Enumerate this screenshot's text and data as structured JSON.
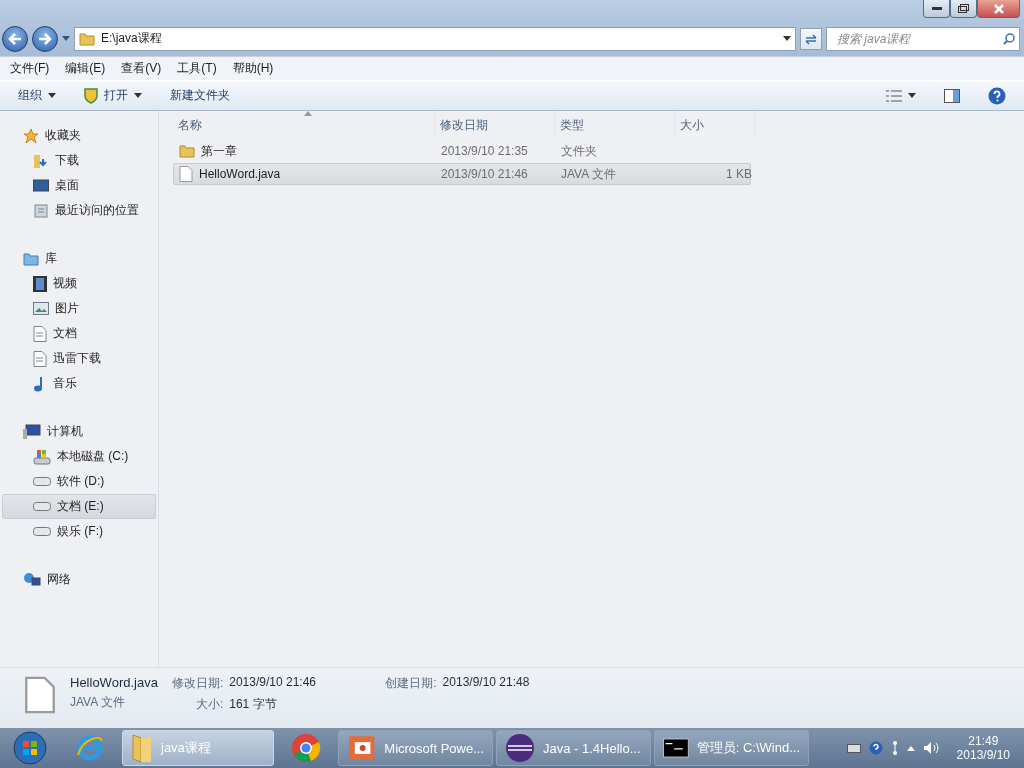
{
  "address": {
    "path": "E:\\java课程",
    "search_placeholder": "搜索 java课程"
  },
  "menu": [
    "文件(F)",
    "编辑(E)",
    "查看(V)",
    "工具(T)",
    "帮助(H)"
  ],
  "toolbar": [
    {
      "label": "组织",
      "kind": "dropdown"
    },
    {
      "label": "打开",
      "kind": "open"
    },
    {
      "label": "新建文件夹",
      "kind": "plain"
    }
  ],
  "sidebar": [
    {
      "label": "收藏夹",
      "kind": "star",
      "children": [
        {
          "label": "下载",
          "kind": "download",
          "selected": false
        },
        {
          "label": "桌面",
          "kind": "desktop",
          "selected": false
        },
        {
          "label": "最近访问的位置",
          "kind": "recent",
          "selected": false
        }
      ]
    },
    {
      "label": "库",
      "kind": "library",
      "children": [
        {
          "label": "视频",
          "kind": "video",
          "selected": false
        },
        {
          "label": "图片",
          "kind": "picture",
          "selected": false
        },
        {
          "label": "文档",
          "kind": "document",
          "selected": false
        },
        {
          "label": "迅雷下载",
          "kind": "document",
          "selected": false
        },
        {
          "label": "音乐",
          "kind": "music",
          "selected": false
        }
      ]
    },
    {
      "label": "计算机",
      "kind": "computer",
      "children": [
        {
          "label": "本地磁盘 (C:)",
          "kind": "system-drive",
          "selected": false
        },
        {
          "label": "软件 (D:)",
          "kind": "drive",
          "selected": false
        },
        {
          "label": "文档 (E:)",
          "kind": "drive",
          "selected": true
        },
        {
          "label": "娱乐 (F:)",
          "kind": "drive",
          "selected": false
        }
      ]
    },
    {
      "label": "网络",
      "kind": "network"
    }
  ],
  "columns": [
    {
      "label": "名称",
      "sorted": true
    },
    {
      "label": "修改日期",
      "sorted": false
    },
    {
      "label": "类型",
      "sorted": false
    },
    {
      "label": "大小",
      "sorted": false
    }
  ],
  "rows": [
    {
      "name": "第一章",
      "date": "2013/9/10 21:35",
      "type": "文件夹",
      "kind": "folder",
      "selected": false
    },
    {
      "name": "HelloWord.java",
      "date": "2013/9/10 21:46",
      "type": "JAVA 文件",
      "size": "1 KB",
      "kind": "file",
      "selected": true
    }
  ],
  "details": {
    "name": "HelloWord.java",
    "type": "JAVA 文件",
    "fields": [
      {
        "label": "修改日期:",
        "value": "2013/9/10 21:46"
      },
      {
        "label": "创建日期:",
        "value": "2013/9/10 21:48"
      },
      {
        "label": "大小:",
        "value": "161 字节"
      }
    ]
  },
  "taskbar": {
    "items": [
      {
        "kind": "start"
      },
      {
        "kind": "ie"
      },
      {
        "kind": "folder",
        "label": "java课程",
        "selected": true
      },
      {
        "kind": "chrome"
      },
      {
        "kind": "powerpoint",
        "label": "Microsoft Powe...",
        "selected": false
      },
      {
        "kind": "eclipse",
        "label": "Java - 1.4Hello...",
        "selected": false
      },
      {
        "kind": "cmd",
        "label": "管理员: C:\\Wind...",
        "selected": false
      }
    ],
    "time": "21:49",
    "date": "2013/9/10"
  }
}
